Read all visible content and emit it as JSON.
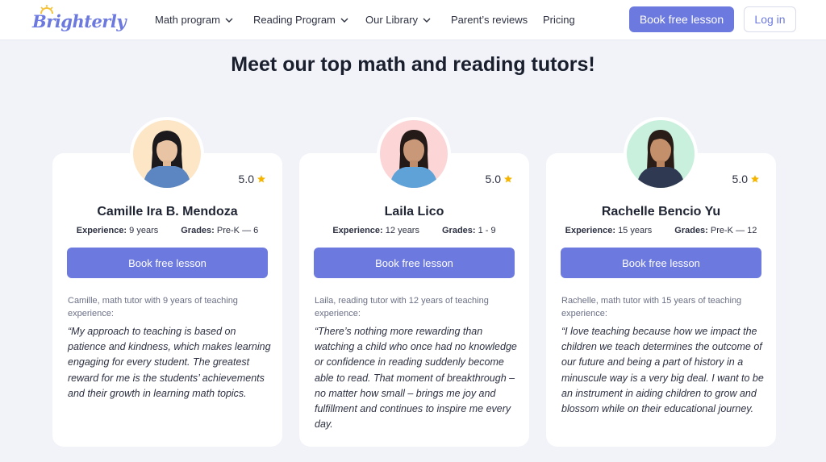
{
  "brand": {
    "logo_text": "Brighterly",
    "accent": "#6c79de"
  },
  "nav": {
    "items": [
      {
        "label": "Math program",
        "dropdown": true
      },
      {
        "label": "Reading Program",
        "dropdown": true
      },
      {
        "label": "Our Library",
        "dropdown": true
      },
      {
        "label": "Parent’s reviews",
        "dropdown": false
      },
      {
        "label": "Pricing",
        "dropdown": false
      }
    ],
    "book_label": "Book free lesson",
    "login_label": "Log in"
  },
  "page_title": "Meet our top math and reading tutors!",
  "tutors": [
    {
      "name": "Camille Ira B. Mendoza",
      "rating": "5.0",
      "experience_label": "Experience:",
      "experience": "9 years",
      "grades_label": "Grades:",
      "grades": "Pre-K — 6",
      "button": "Book free lesson",
      "intro": "Camille, math tutor with 9 years of teaching experience:",
      "quote": "“My approach to teaching is based on patience and kindness, which makes learning engaging for every student. The greatest reward for me is the students’ achievements and their growth in learning math topics.",
      "avatar_bg": "#fde6c6",
      "shirt": "#5b86c2"
    },
    {
      "name": "Laila Lico",
      "rating": "5.0",
      "experience_label": "Experience:",
      "experience": "12 years",
      "grades_label": "Grades:",
      "grades": "1 - 9",
      "button": "Book free lesson",
      "intro": "Laila, reading tutor with 12 years of teaching experience:",
      "quote": "“There’s nothing more rewarding than watching a child who once had no knowledge or confidence in reading suddenly become able to read. That moment of breakthrough – no matter how small – brings me joy and fulfillment and continues to inspire me every day.",
      "avatar_bg": "#fcd6d6",
      "shirt": "#5fa2d8"
    },
    {
      "name": "Rachelle Bencio Yu",
      "rating": "5.0",
      "experience_label": "Experience:",
      "experience": "15 years",
      "grades_label": "Grades:",
      "grades": "Pre-K — 12",
      "button": "Book free lesson",
      "intro": "Rachelle, math tutor with 15 years of teaching experience:",
      "quote": "“I love teaching because how we impact the children we teach determines the outcome of our future and being a part of history in a minuscule way is a very big deal. I want to be an instrument in aiding children to grow and blossom while on their educational journey.",
      "avatar_bg": "#c8f0dc",
      "shirt": "#2f3a52"
    }
  ],
  "icons": {
    "star": "star-icon",
    "chevron": "chevron-down-icon"
  },
  "colors": {
    "star": "#f5b400",
    "page_bg": "#f1f3f9",
    "card_bg": "#ffffff"
  }
}
